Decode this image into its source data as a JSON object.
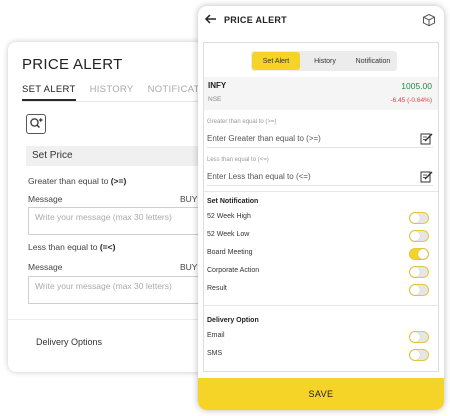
{
  "back_panel": {
    "title": "PRICE ALERT",
    "tabs": [
      "SET ALERT",
      "HISTORY",
      "NOTIFICATION"
    ],
    "active_tab": "SET ALERT",
    "zoom_icon": "zoom-in-icon",
    "set_price_label": "Set Price",
    "greater_label": "Greater than equal to ",
    "greater_symbol": "(>=)",
    "message_label_1": "Message",
    "buy_label_1": "BUY",
    "message_placeholder_1": "Write your message (max 30 letters)",
    "less_label": "Less than equal to ",
    "less_symbol": "(=<)",
    "message_label_2": "Message",
    "buy_label_2": "BUY",
    "message_placeholder_2": "Write your message (max 30 letters)",
    "delivery_options": "Delivery Options"
  },
  "phone": {
    "title": "PRICE ALERT",
    "back_icon": "arrow-left-icon",
    "cube_icon": "cube-icon",
    "segments": [
      "Set Alert",
      "History",
      "Notification"
    ],
    "active_segment": "Set Alert",
    "stock": {
      "symbol": "INFY",
      "exchange": "NSE",
      "price": "1005.00",
      "change": "-6.45 (-0.64%)"
    },
    "greater": {
      "label": "Greater than equal to (>=)",
      "placeholder": "Enter Greater than equal to (>=)"
    },
    "less": {
      "label": "Less than equal to (<=)",
      "placeholder": "Enter Less than equal to (<=)"
    },
    "set_notification_title": "Set Notification",
    "notifications": [
      {
        "label": "52 Week High",
        "on": false
      },
      {
        "label": "52 Week Low",
        "on": false
      },
      {
        "label": "Board Meeting",
        "on": true
      },
      {
        "label": "Corporate Action",
        "on": false
      },
      {
        "label": "Result",
        "on": false
      }
    ],
    "delivery_title": "Delivery Option",
    "delivery": [
      {
        "label": "Email",
        "on": false
      },
      {
        "label": "SMS",
        "on": false
      }
    ],
    "save_label": "SAVE"
  },
  "colors": {
    "accent": "#f5d327",
    "price_up": "#1e8e3e",
    "price_down": "#e04040"
  }
}
